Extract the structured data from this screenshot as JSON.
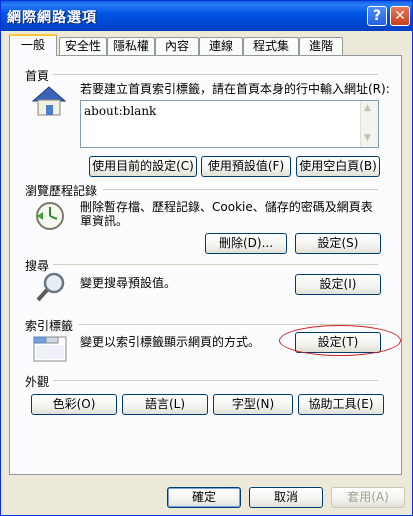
{
  "window": {
    "title": "網際網路選項",
    "help_glyph": "?",
    "close_glyph": "✕"
  },
  "tabs": [
    {
      "label": "一般"
    },
    {
      "label": "安全性"
    },
    {
      "label": "隱私權"
    },
    {
      "label": "內容"
    },
    {
      "label": "連線"
    },
    {
      "label": "程式集"
    },
    {
      "label": "進階"
    }
  ],
  "home": {
    "label": "首頁",
    "description": "若要建立首頁索引標籤，請在首頁本身的行中輸入網址(R):",
    "value": "about:blank",
    "buttons": {
      "use_current": "使用目前的設定(C)",
      "use_default": "使用預設值(F)",
      "use_blank": "使用空白頁(B)"
    }
  },
  "history": {
    "label": "瀏覽歷程記錄",
    "description": "刪除暫存檔、歷程記錄、Cookie、儲存的密碼及網頁表單資訊。",
    "buttons": {
      "delete": "刪除(D)...",
      "settings": "設定(S)"
    }
  },
  "search": {
    "label": "搜尋",
    "description": "變更搜尋預設值。",
    "buttons": {
      "settings": "設定(I)"
    }
  },
  "tabs_section": {
    "label": "索引標籤",
    "description": "變更以索引標籤顯示網頁的方式。",
    "buttons": {
      "settings": "設定(T)"
    }
  },
  "appearance": {
    "label": "外觀",
    "buttons": {
      "colors": "色彩(O)",
      "languages": "語言(L)",
      "fonts": "字型(N)",
      "accessibility": "協助工具(E)"
    }
  },
  "footer": {
    "ok": "確定",
    "cancel": "取消",
    "apply": "套用(A)"
  }
}
